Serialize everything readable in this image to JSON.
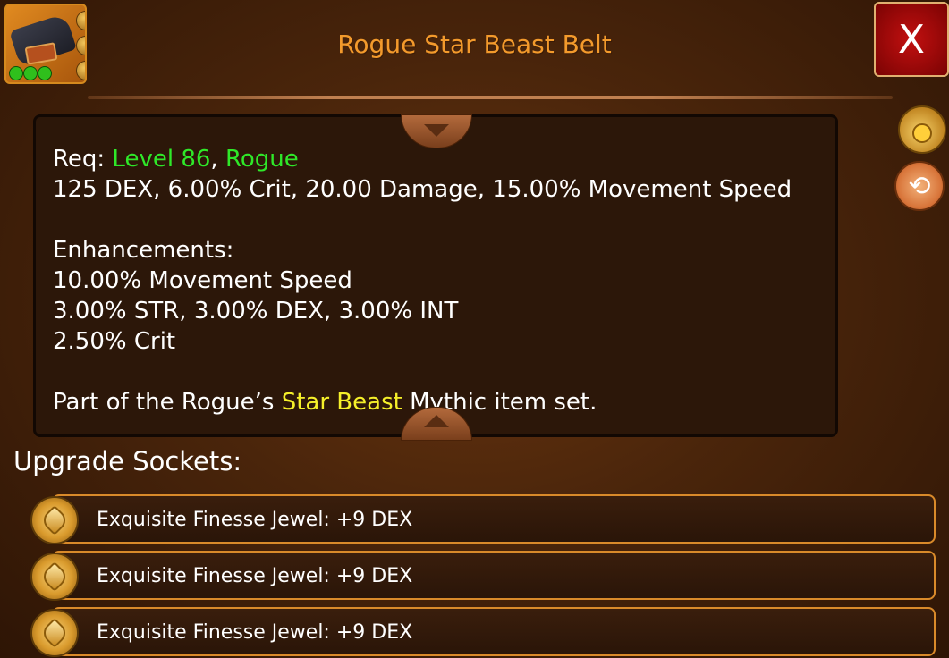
{
  "header": {
    "title": "Rogue Star Beast Belt",
    "close_label": "X",
    "item_icon": "belt-icon"
  },
  "details": {
    "req_prefix": "Req: ",
    "req_level": "Level 86",
    "req_sep": ", ",
    "req_class": "Rogue",
    "stats_line": "125 DEX, 6.00% Crit, 20.00 Damage, 15.00% Movement Speed",
    "enhancements_header": "Enhancements:",
    "enhancements": [
      "10.00% Movement Speed",
      "3.00% STR, 3.00% DEX, 3.00% INT",
      "2.50% Crit"
    ],
    "set_prefix": "Part of the Rogue’s ",
    "set_name": "Star Beast",
    "set_suffix": " Mythic item set."
  },
  "side_icons": [
    "coin-bag-icon",
    "recycle-icon"
  ],
  "sockets": {
    "label": "Upgrade Sockets:",
    "items": [
      {
        "label": "Exquisite Finesse Jewel: +9 DEX"
      },
      {
        "label": "Exquisite Finesse Jewel: +9 DEX"
      },
      {
        "label": "Exquisite Finesse Jewel: +9 DEX"
      }
    ]
  },
  "colors": {
    "title": "#f39a2c",
    "requirement": "#2fe829",
    "set_name": "#f5f02a",
    "close_button": "#c21010"
  }
}
